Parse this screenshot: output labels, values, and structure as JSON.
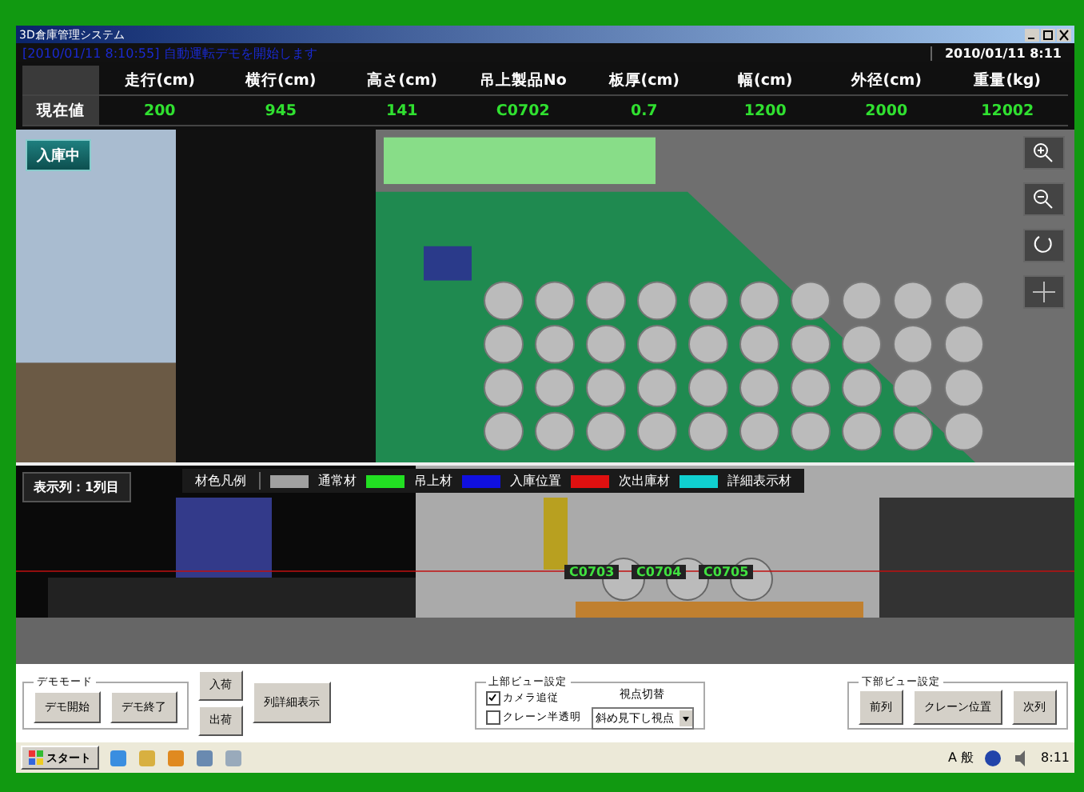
{
  "window": {
    "title": "3D倉庫管理システム"
  },
  "message": "[2010/01/11 8:10:55] 自動運転デモを開始します",
  "datetime": "2010/01/11 8:11",
  "table": {
    "columns": [
      "走行(cm)",
      "横行(cm)",
      "高さ(cm)",
      "吊上製品No",
      "板厚(cm)",
      "幅(cm)",
      "外径(cm)",
      "重量(kg)"
    ],
    "row_label": "現在値",
    "values": [
      "200",
      "945",
      "141",
      "C0702",
      "0.7",
      "1200",
      "2000",
      "12002"
    ]
  },
  "status_button": "入庫中",
  "lower_view": {
    "column_label": "表示列：1列目",
    "legend_title": "材色凡例",
    "legend": [
      {
        "label": "通常材",
        "color": "#a0a0a0"
      },
      {
        "label": "吊上材",
        "color": "#22e022"
      },
      {
        "label": "入庫位置",
        "color": "#1010e0"
      },
      {
        "label": "次出庫材",
        "color": "#e01010"
      },
      {
        "label": "詳細表示材",
        "color": "#10d0d0"
      }
    ],
    "coils": [
      "C0703",
      "C0704",
      "C0705"
    ]
  },
  "demo_mode": {
    "title": "デモモード",
    "buttons": [
      "デモ開始",
      "デモ終了"
    ]
  },
  "io_buttons": [
    "入荷",
    "出荷"
  ],
  "detail_button": "列詳細表示",
  "upper_view_settings": {
    "title": "上部ビュー設定",
    "checkboxes": [
      {
        "label": "カメラ追従",
        "checked": true
      },
      {
        "label": "クレーン半透明",
        "checked": false
      }
    ],
    "viewpoint_label": "視点切替",
    "viewpoint": "斜め見下し視点"
  },
  "lower_view_settings": {
    "title": "下部ビュー設定",
    "buttons": [
      "前列",
      "クレーン位置",
      "次列"
    ]
  },
  "taskbar": {
    "start": "スタート",
    "ime": "A 般",
    "clock": "8:11"
  }
}
